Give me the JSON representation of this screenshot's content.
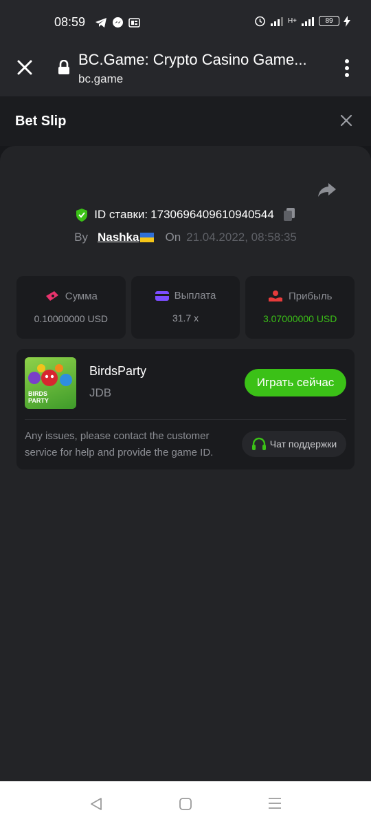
{
  "status_bar": {
    "time": "08:59",
    "battery": "89",
    "network": "H+",
    "left_icons": [
      "telegram-icon",
      "messenger-icon",
      "notification-icon"
    ],
    "right_icons": [
      "alarm-icon",
      "signal-icon",
      "battery-icon",
      "charging-icon"
    ]
  },
  "browser": {
    "title": "BC.Game: Crypto Casino Game...",
    "domain": "bc.game"
  },
  "bet_slip": {
    "title": "Bet Slip",
    "bet_id_label": "ID ставки:",
    "bet_id": "1730696409610940544",
    "by_label": "By",
    "username": "Nashka",
    "on_label": "On",
    "date": "21.04.2022, 08:58:35",
    "stats": [
      {
        "label": "Сумма",
        "value": "0.10000000 USD",
        "icon": "money-icon",
        "color": "#e8336d"
      },
      {
        "label": "Выплата",
        "value": "31.7 x",
        "icon": "card-icon",
        "color": "#7b4dff"
      },
      {
        "label": "Прибыль",
        "value": "3.07000000 USD",
        "icon": "profit-icon",
        "color": "#e63b3b"
      }
    ],
    "game": {
      "name": "BirdsParty",
      "provider": "JDB",
      "thumb_text_line1": "BIRDS",
      "thumb_text_line2": "PARTY",
      "play_label": "Играть сейчас"
    },
    "issue_text": "Any issues, please contact the customer service for help and provide the game ID.",
    "support_label": "Чат поддержки"
  },
  "colors": {
    "accent_green": "#3bc117",
    "panel": "#232427",
    "card": "#1a1b1e"
  }
}
